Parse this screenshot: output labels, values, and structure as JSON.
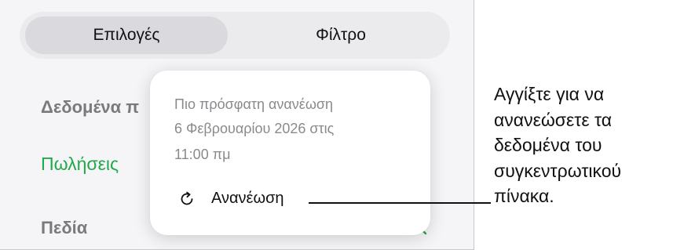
{
  "segmented": {
    "options_label": "Επιλογές",
    "filter_label": "Φίλτρο"
  },
  "sections": {
    "data_heading": "Δεδομένα π",
    "data_source": "Πωλήσεις",
    "fields_heading": "Πεδία"
  },
  "popover": {
    "last_refresh_label": "Πιο πρόσφατη ανανέωση",
    "date_line1": "6 Φεβρουαρίου 2026 στις",
    "date_line2": "11:00 πμ",
    "refresh_button": "Ανανέωση"
  },
  "callout": {
    "lines": [
      "Αγγίξτε για να",
      "ανανεώσετε τα",
      "δεδομένα του",
      "συγκεντρωτικού",
      "πίνακα."
    ]
  },
  "colors": {
    "accent": "#23a84b",
    "panel_bg": "#f5f5f7",
    "selected_segment": "#dadade"
  },
  "icons": {
    "refresh": "refresh-icon",
    "search": "search-icon"
  }
}
